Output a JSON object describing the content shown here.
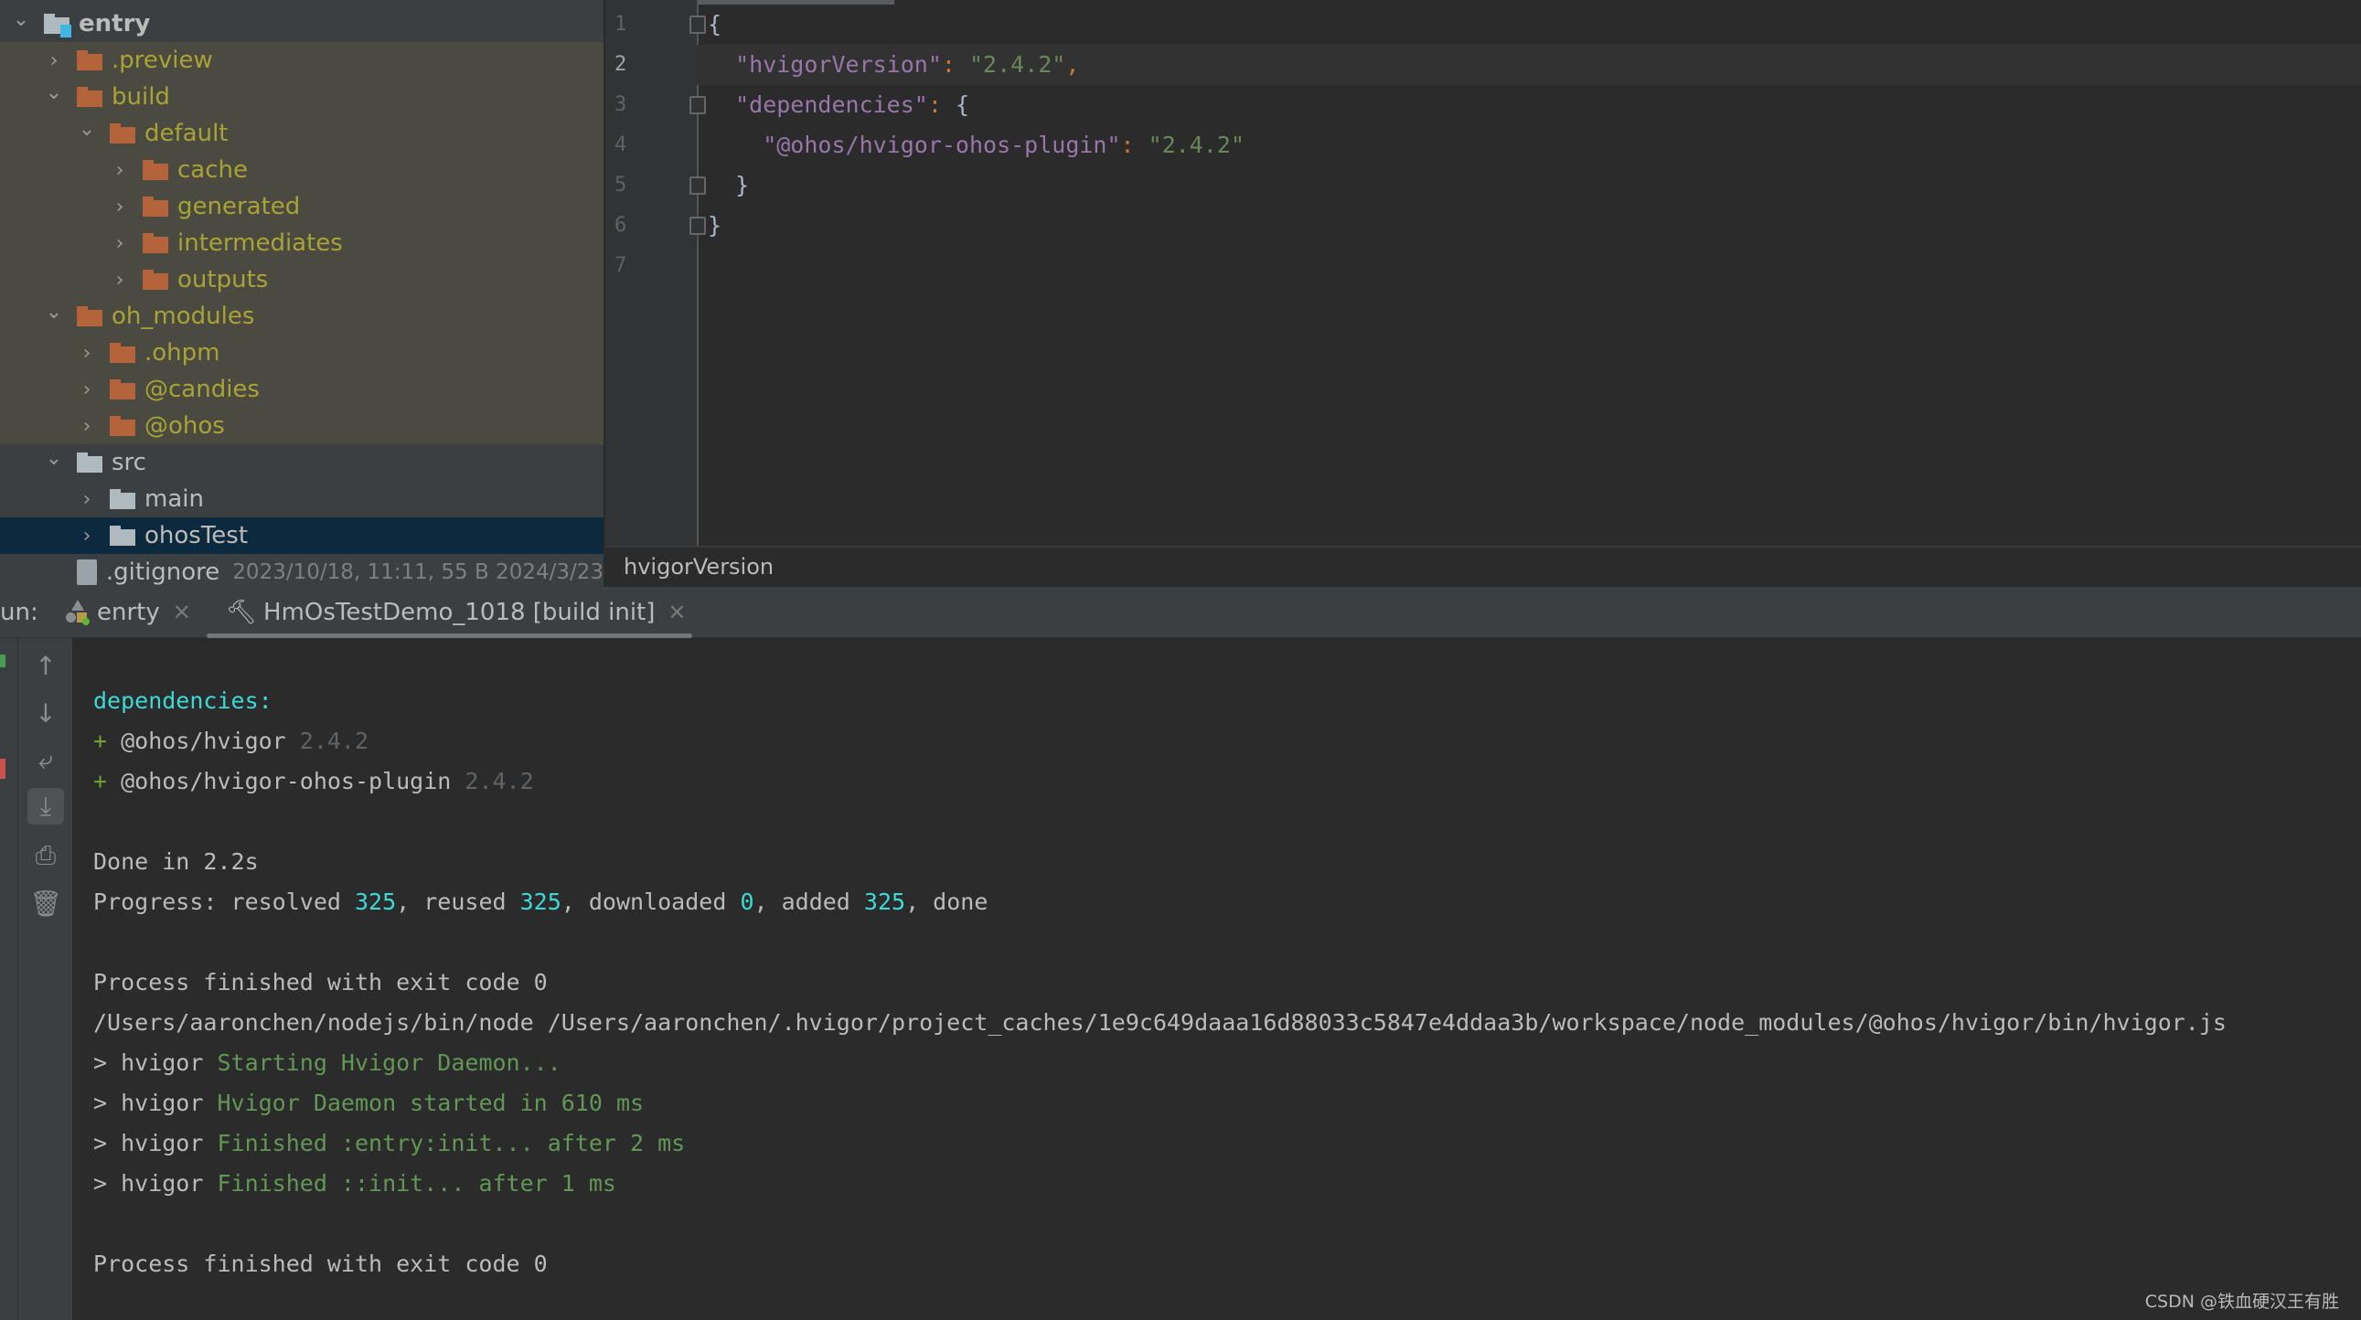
{
  "project_tree": {
    "items": [
      {
        "label": "entry",
        "depth": 0,
        "expanded": true,
        "icon": "module-folder-icon",
        "style": "top"
      },
      {
        "label": ".preview",
        "depth": 1,
        "expanded": false,
        "icon": "folder-icon",
        "style": "excluded"
      },
      {
        "label": "build",
        "depth": 1,
        "expanded": true,
        "icon": "folder-icon",
        "style": "excluded"
      },
      {
        "label": "default",
        "depth": 2,
        "expanded": true,
        "icon": "folder-icon",
        "style": "excluded"
      },
      {
        "label": "cache",
        "depth": 3,
        "expanded": false,
        "icon": "folder-icon",
        "style": "excluded"
      },
      {
        "label": "generated",
        "depth": 3,
        "expanded": false,
        "icon": "folder-icon",
        "style": "excluded"
      },
      {
        "label": "intermediates",
        "depth": 3,
        "expanded": false,
        "icon": "folder-icon",
        "style": "excluded"
      },
      {
        "label": "outputs",
        "depth": 3,
        "expanded": false,
        "icon": "folder-icon",
        "style": "excluded"
      },
      {
        "label": "oh_modules",
        "depth": 1,
        "expanded": true,
        "icon": "folder-icon",
        "style": "excluded"
      },
      {
        "label": ".ohpm",
        "depth": 2,
        "expanded": false,
        "icon": "folder-icon",
        "style": "excluded"
      },
      {
        "label": "@candies",
        "depth": 2,
        "expanded": false,
        "icon": "folder-icon",
        "style": "excluded"
      },
      {
        "label": "@ohos",
        "depth": 2,
        "expanded": false,
        "icon": "folder-icon",
        "style": "excluded"
      },
      {
        "label": "src",
        "depth": 1,
        "expanded": true,
        "icon": "folder-icon",
        "style": "normal"
      },
      {
        "label": "main",
        "depth": 2,
        "expanded": false,
        "icon": "folder-icon",
        "style": "normal"
      },
      {
        "label": "ohosTest",
        "depth": 2,
        "expanded": false,
        "icon": "folder-icon",
        "style": "selected"
      },
      {
        "label": ".gitignore",
        "depth": 1,
        "icon": "gitignore-file-icon",
        "style": "normal",
        "meta": "2023/10/18, 11:11, 55 B 2024/3/23"
      }
    ]
  },
  "editor": {
    "line_numbers": [
      "1",
      "2",
      "3",
      "4",
      "5",
      "6",
      "7"
    ],
    "current_line": 2,
    "lines": [
      [
        {
          "t": "{",
          "c": "b"
        }
      ],
      [
        {
          "t": "  \"hvigorVersion\"",
          "c": "k"
        },
        {
          "t": ": ",
          "c": "p"
        },
        {
          "t": "\"2.4.2\"",
          "c": "s"
        },
        {
          "t": ",",
          "c": "p"
        }
      ],
      [
        {
          "t": "  \"dependencies\"",
          "c": "k"
        },
        {
          "t": ": ",
          "c": "p"
        },
        {
          "t": "{",
          "c": "b"
        }
      ],
      [
        {
          "t": "    \"@ohos/hvigor-ohos-plugin\"",
          "c": "k"
        },
        {
          "t": ": ",
          "c": "p"
        },
        {
          "t": "\"2.4.2\"",
          "c": "s"
        }
      ],
      [
        {
          "t": "  }",
          "c": "b"
        }
      ],
      [
        {
          "t": "}",
          "c": "b"
        }
      ],
      []
    ],
    "breadcrumb": "hvigorVersion"
  },
  "run_panel": {
    "label": "un:",
    "tabs": [
      {
        "label": "enrty",
        "icon": "run-config-icon",
        "active": false
      },
      {
        "label": "HmOsTestDemo_1018 [build init]",
        "icon": "hammer-icon",
        "active": true
      }
    ],
    "tools": [
      "arrow-up-icon",
      "arrow-down-icon",
      "soft-wrap-icon",
      "scroll-to-end-icon",
      "print-icon",
      "trash-icon"
    ],
    "output": [
      [
        {
          "t": "dependencies:",
          "c": "cyan"
        }
      ],
      [
        {
          "t": "+ ",
          "c": "plus"
        },
        {
          "t": "@ohos/hvigor "
        },
        {
          "t": "2.4.2",
          "c": "dim"
        }
      ],
      [
        {
          "t": "+ ",
          "c": "plus"
        },
        {
          "t": "@ohos/hvigor-ohos-plugin "
        },
        {
          "t": "2.4.2",
          "c": "dim"
        }
      ],
      [],
      [
        {
          "t": "Done in 2.2s"
        }
      ],
      [
        {
          "t": "Progress: resolved "
        },
        {
          "t": "325",
          "c": "cyan"
        },
        {
          "t": ", reused "
        },
        {
          "t": "325",
          "c": "cyan"
        },
        {
          "t": ", downloaded "
        },
        {
          "t": "0",
          "c": "cyan"
        },
        {
          "t": ", added "
        },
        {
          "t": "325",
          "c": "cyan"
        },
        {
          "t": ", done"
        }
      ],
      [],
      [
        {
          "t": "Process finished with exit code 0"
        }
      ],
      [
        {
          "t": "/Users/aaronchen/nodejs/bin/node /Users/aaronchen/.hvigor/project_caches/1e9c649daaa16d88033c5847e4ddaa3b/workspace/node_modules/@ohos/hvigor/bin/hvigor.js"
        }
      ],
      [
        {
          "t": "> hvigor "
        },
        {
          "t": "Starting Hvigor Daemon...",
          "c": "grn"
        }
      ],
      [
        {
          "t": "> hvigor "
        },
        {
          "t": "Hvigor Daemon started in 610 ms",
          "c": "grn"
        }
      ],
      [
        {
          "t": "> hvigor "
        },
        {
          "t": "Finished :entry:init... after 2 ms",
          "c": "grn"
        }
      ],
      [
        {
          "t": "> hvigor "
        },
        {
          "t": "Finished ::init... after 1 ms",
          "c": "grn"
        }
      ],
      [],
      [
        {
          "t": "Process finished with exit code 0"
        }
      ]
    ]
  },
  "watermark": "CSDN @铁血硬汉王有胜",
  "colors": {
    "folder_excluded": "#b4633a",
    "folder_normal": "#aeb9c0",
    "selection": "#0d293e",
    "cyan": "#3dd8d8",
    "green": "#629755"
  }
}
